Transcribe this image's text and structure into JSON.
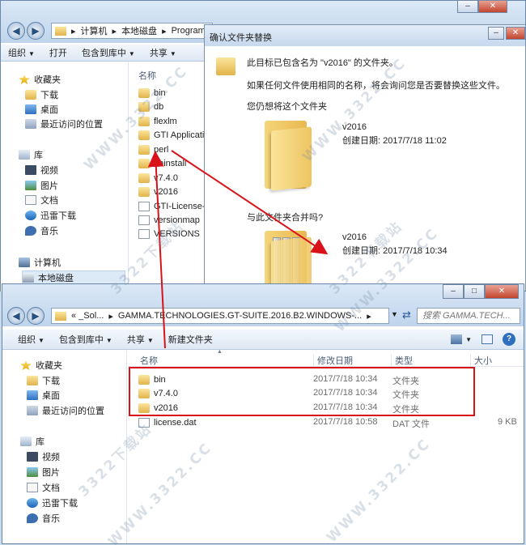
{
  "back_window": {
    "address_parts": [
      "计算机",
      "本地磁盘",
      "Program"
    ],
    "toolbar": [
      "组织",
      "打开",
      "包含到库中",
      "共享"
    ],
    "column_name": "名称",
    "nav": [
      "收藏夹",
      "下载",
      "桌面",
      "最近访问的位置",
      "库",
      "视频",
      "图片",
      "文档",
      "迅雷下载",
      "音乐",
      "计算机",
      "本地磁盘"
    ],
    "files": [
      "bin",
      "db",
      "flexlm",
      "GTI Applicatio",
      "perl",
      "uninstall",
      "v7.4.0",
      "v2016",
      "GTI-License-S",
      "versionmap",
      "VERSIONS"
    ]
  },
  "dialog": {
    "title": "确认文件夹替换",
    "line1": "此目标已包含名为 \"v2016\" 的文件夹。",
    "line2": "如果任何文件使用相同的名称，将会询问您是否要替换这些文件。",
    "line3": "您仍想将这个文件夹",
    "src_name": "v2016",
    "src_date": "创建日期: 2017/7/18 11:02",
    "merge_label": "与此文件夹合并吗?",
    "dst_name": "v2016",
    "dst_date": "创建日期: 2017/7/18 10:34"
  },
  "front_window": {
    "address": [
      "«  _Sol...",
      "GAMMA.TECHNOLOGIES.GT-SUITE.2016.B2.WINDOWS-..."
    ],
    "search_placeholder": "搜索 GAMMA.TECH...",
    "toolbar": [
      "组织",
      "包含到库中",
      "共享",
      "新建文件夹"
    ],
    "columns": {
      "name": "名称",
      "date": "修改日期",
      "type": "类型",
      "size": "大小"
    },
    "nav": [
      "收藏夹",
      "下载",
      "桌面",
      "最近访问的位置",
      "库",
      "视频",
      "图片",
      "文档",
      "迅雷下载",
      "音乐"
    ],
    "files": [
      {
        "name": "bin",
        "date": "2017/7/18 10:34",
        "type": "文件夹",
        "size": ""
      },
      {
        "name": "v7.4.0",
        "date": "2017/7/18 10:34",
        "type": "文件夹",
        "size": ""
      },
      {
        "name": "v2016",
        "date": "2017/7/18 10:34",
        "type": "文件夹",
        "size": ""
      },
      {
        "name": "license.dat",
        "date": "2017/7/18 10:58",
        "type": "DAT 文件",
        "size": "9 KB"
      }
    ]
  },
  "watermark": "WWW.3322.CC",
  "watermark_cn": "3322下载站",
  "colors": {
    "highlight_box": "#d9121a",
    "arrow": "#d9121a",
    "selection": "#dce9f7"
  }
}
